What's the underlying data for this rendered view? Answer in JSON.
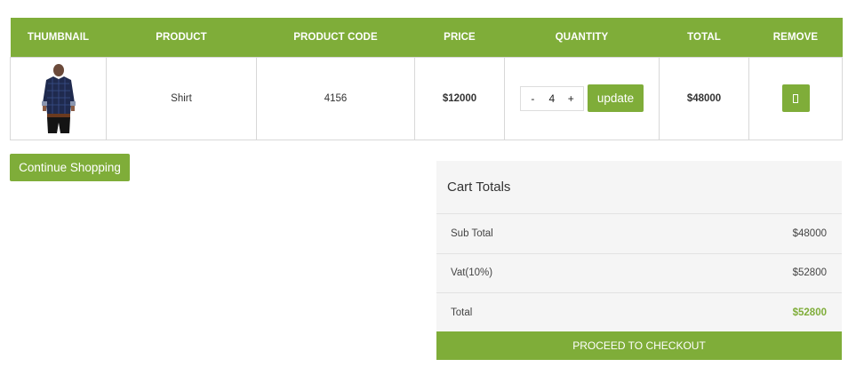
{
  "table": {
    "headers": [
      "Thumbnail",
      "Product",
      "Product Code",
      "Price",
      "Quantity",
      "Total",
      "Remove"
    ],
    "rows": [
      {
        "thumbnail": "shirt-product-image",
        "product": "Shirt",
        "code": "4156",
        "price": "$12000",
        "qty_minus": "-",
        "quantity": "4",
        "qty_plus": "+",
        "update_label": "update",
        "total": "$48000",
        "remove_icon": "remove-icon"
      }
    ]
  },
  "continue_label": "Continue Shopping",
  "totals": {
    "title": "Cart Totals",
    "rows": [
      {
        "label": "Sub Total",
        "value": "$48000"
      },
      {
        "label": "Vat(10%)",
        "value": "$52800"
      },
      {
        "label": "Total",
        "value": "$52800"
      }
    ],
    "checkout_label": "Proceed to Checkout"
  },
  "colors": {
    "accent": "#7fad39",
    "panel_bg": "#f5f5f5"
  }
}
